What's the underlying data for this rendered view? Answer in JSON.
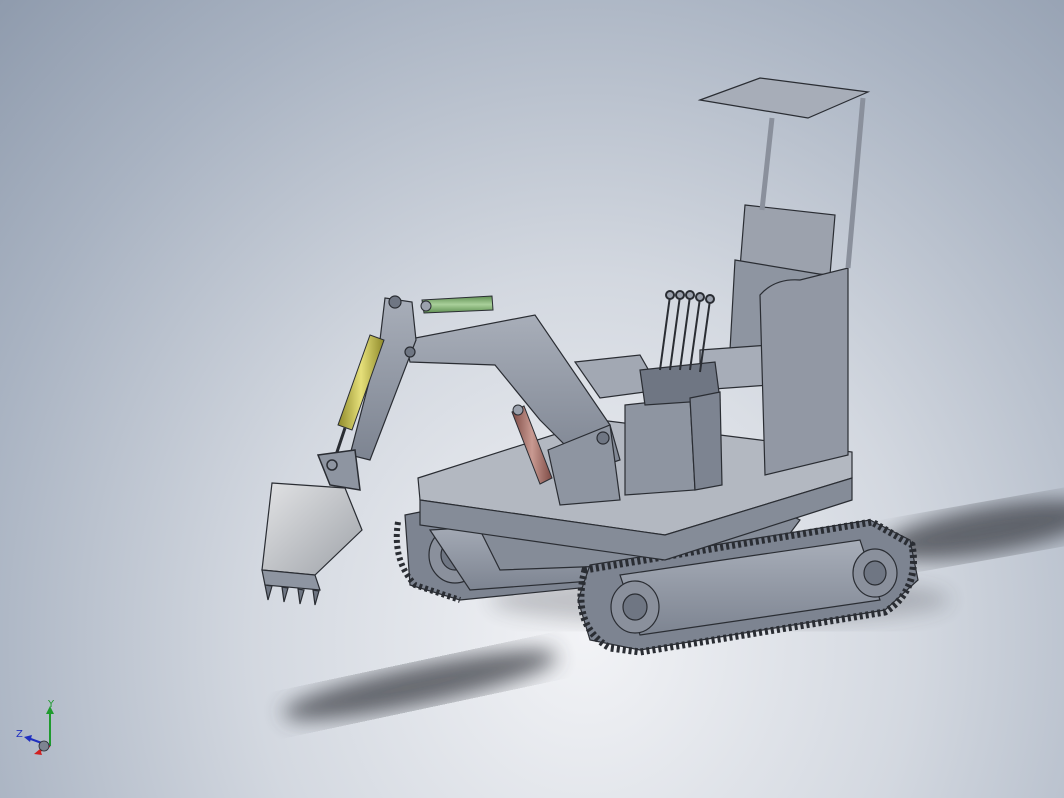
{
  "viewport": {
    "background_top": "#8f9bad",
    "background_bottom": "#f2f3f6"
  },
  "model": {
    "colors": {
      "body": "#9ba1ad",
      "body_dark": "#6f7683",
      "outline": "#2a2d33",
      "arm_cylinder": "#c8c24a",
      "boom_cylinder": "#b07a72",
      "bucket_cylinder": "#7fa872",
      "bucket": "#c9cbcf",
      "canopy": "#a7adb8",
      "shadow": "#3d4047"
    }
  },
  "triad": {
    "y_label": "Y",
    "z_label": "Z",
    "y_color": "#1f9a2e",
    "x_color": "#d02020",
    "z_color": "#2030c0"
  }
}
